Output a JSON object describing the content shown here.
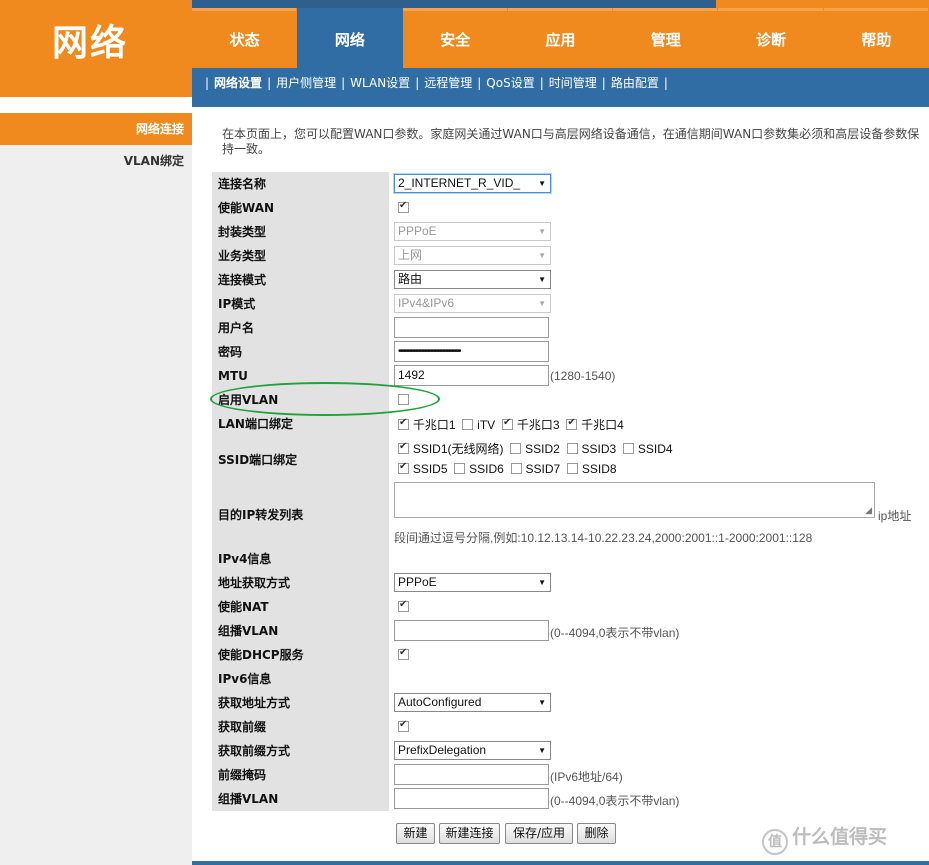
{
  "header": {
    "logo": "网络",
    "tabs": [
      "状态",
      "网络",
      "安全",
      "应用",
      "管理",
      "诊断",
      "帮助"
    ],
    "active_tab": "网络",
    "subnav": [
      "网络设置",
      "用户侧管理",
      "WLAN设置",
      "远程管理",
      "QoS设置",
      "时间管理",
      "路由配置"
    ]
  },
  "sidebar": {
    "items": [
      "网络连接",
      "VLAN绑定"
    ]
  },
  "intro": "在本页面上，您可以配置WAN口参数。家庭网关通过WAN口与高层网络设备通信，在通信期间WAN口参数集必须和高层设备参数保持一致。",
  "form": {
    "conn_name": {
      "label": "连接名称",
      "value": "2_INTERNET_R_VID_"
    },
    "enable_wan": {
      "label": "使能WAN",
      "checked": true
    },
    "encap": {
      "label": "封装类型",
      "value": "PPPoE"
    },
    "service": {
      "label": "业务类型",
      "value": "上网"
    },
    "conn_mode": {
      "label": "连接模式",
      "value": "路由"
    },
    "ip_mode": {
      "label": "IP模式",
      "value": "IPv4&IPv6"
    },
    "username": {
      "label": "用户名",
      "value": ""
    },
    "password": {
      "label": "密码",
      "value": "•••••••••••••••••••••••••••••••••••••••••"
    },
    "mtu": {
      "label": "MTU",
      "value": "1492",
      "hint": "(1280-1540)"
    },
    "enable_vlan": {
      "label": "启用VLAN",
      "checked": false
    },
    "lan_bind": {
      "label": "LAN端口绑定",
      "options": [
        {
          "name": "千兆口1",
          "checked": true
        },
        {
          "name": "iTV",
          "checked": false
        },
        {
          "name": "千兆口3",
          "checked": true
        },
        {
          "name": "千兆口4",
          "checked": true
        }
      ]
    },
    "ssid_bind": {
      "label": "SSID端口绑定",
      "row1": [
        {
          "name": "SSID1(无线网络)",
          "checked": true
        },
        {
          "name": "SSID2",
          "checked": false
        },
        {
          "name": "SSID3",
          "checked": false
        },
        {
          "name": "SSID4",
          "checked": false
        }
      ],
      "row2": [
        {
          "name": "SSID5",
          "checked": true
        },
        {
          "name": "SSID6",
          "checked": false
        },
        {
          "name": "SSID7",
          "checked": false
        },
        {
          "name": "SSID8",
          "checked": false
        }
      ]
    },
    "dest_ip": {
      "label": "目的IP转发列表",
      "suffix": "ip地址",
      "hint": "段间通过逗号分隔,例如:10.12.13.14-10.22.23.24,2000:2001::1-2000:2001::128"
    },
    "ipv4_title": "IPv4信息",
    "addr_method": {
      "label": "地址获取方式",
      "value": "PPPoE"
    },
    "enable_nat": {
      "label": "使能NAT",
      "checked": true
    },
    "multicast_vlan4": {
      "label": "组播VLAN",
      "value": "",
      "hint": "(0--4094,0表示不带vlan)"
    },
    "enable_dhcp": {
      "label": "使能DHCP服务",
      "checked": true
    },
    "ipv6_title": "IPv6信息",
    "get_addr_method": {
      "label": "获取地址方式",
      "value": "AutoConfigured"
    },
    "get_prefix": {
      "label": "获取前缀",
      "checked": true
    },
    "prefix_method": {
      "label": "获取前缀方式",
      "value": "PrefixDelegation"
    },
    "prefix_mask": {
      "label": "前缀掩码",
      "value": "",
      "hint": "(IPv6地址/64)"
    },
    "multicast_vlan6": {
      "label": "组播VLAN",
      "value": "",
      "hint": "(0--4094,0表示不带vlan)"
    }
  },
  "buttons": [
    "新建",
    "新建连接",
    "保存/应用",
    "删除"
  ],
  "watermark": "什么值得买",
  "watermark_icon": "值"
}
